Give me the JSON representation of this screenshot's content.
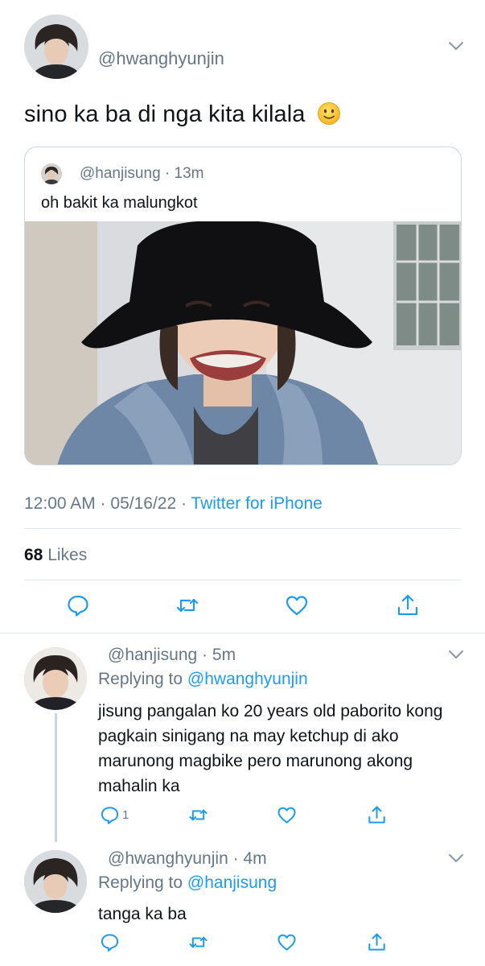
{
  "main_tweet": {
    "handle": "@hwanghyunjin",
    "text": "sino ka ba di nga kita kilala",
    "emoji": "slightly-smiling-face",
    "timestamp": "12:00 AM · 05/16/22 · ",
    "source": "Twitter for iPhone",
    "likes_count": "68",
    "likes_label": "Likes"
  },
  "quoted_tweet": {
    "handle": "@hanjisung · 13m",
    "text": "oh bakit ka malungkot"
  },
  "replies": [
    {
      "handle": "@hanjisung · 5m",
      "replying_prefix": "Replying to ",
      "replying_to": "@hwanghyunjin",
      "text": "jisung pangalan ko 20 years old paborito kong pagkain sinigang na may ketchup di ako marunong magbike pero marunong akong mahalin ka",
      "reply_count": "1"
    },
    {
      "handle": "@hwanghyunjin · 4m",
      "replying_prefix": "Replying to ",
      "replying_to": "@hanjisung",
      "text": "tanga ka ba"
    }
  ],
  "colors": {
    "link": "#1d9bf0",
    "secondary_text": "#657786",
    "icon": "#1d9bf0",
    "divider": "#e1e8ed"
  }
}
